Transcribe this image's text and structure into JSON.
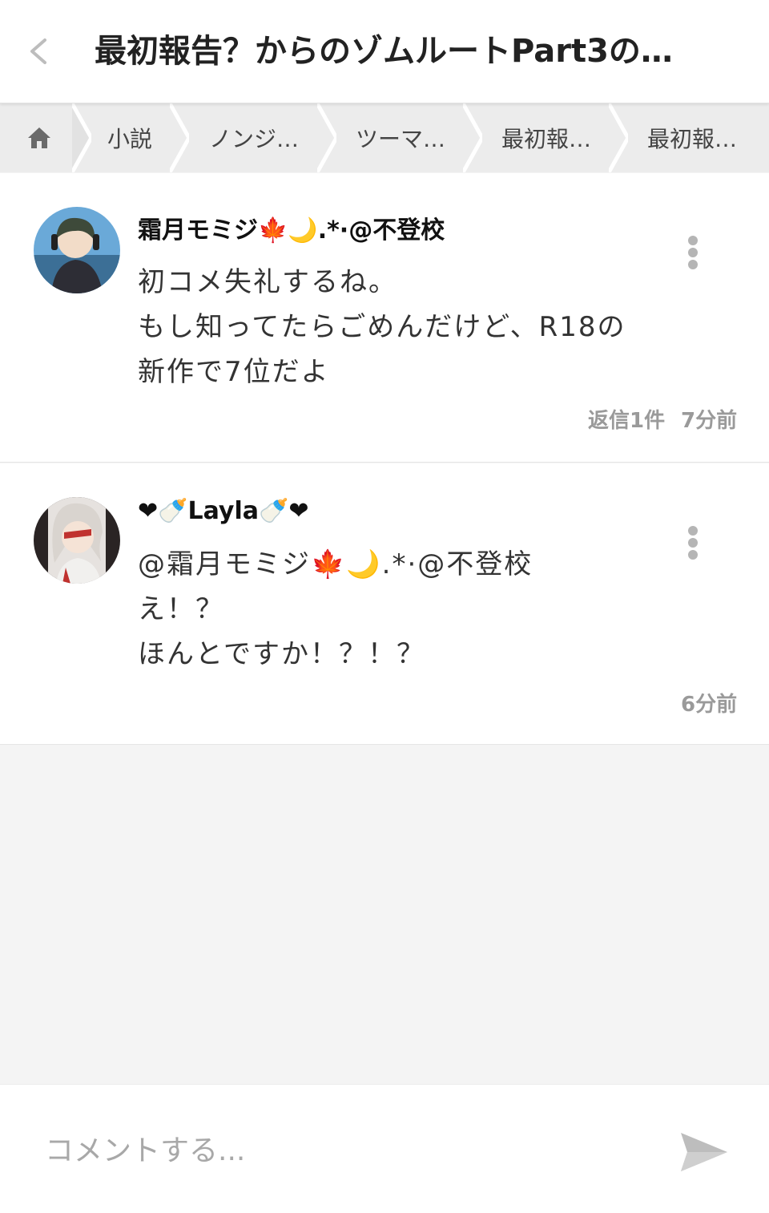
{
  "header": {
    "title": "最初報告？からのゾムルートPart3の…"
  },
  "breadcrumb": {
    "items": [
      {
        "label": "小説"
      },
      {
        "label": "ノンジ…"
      },
      {
        "label": "ツーマ…"
      },
      {
        "label": "最初報…"
      },
      {
        "label": "最初報…"
      }
    ]
  },
  "comments": [
    {
      "author": "霜月モミジ🍁🌙.*·@不登校",
      "lines": [
        "初コメ失礼するね。",
        "もし知ってたらごめんだけど、R18の",
        "新作で7位だよ"
      ],
      "replies": "返信1件",
      "time": "7分前"
    },
    {
      "author": "❤🍼Layla🍼❤",
      "lines": [
        "@霜月モミジ🍁🌙.*·@不登校",
        "え！？",
        "ほんとですか！？！？"
      ],
      "time": "6分前"
    }
  ],
  "compose": {
    "placeholder": "コメントする..."
  },
  "colors": {
    "accent": "#bdbdbd",
    "background": "#f4f4f4",
    "card": "#ffffff"
  }
}
